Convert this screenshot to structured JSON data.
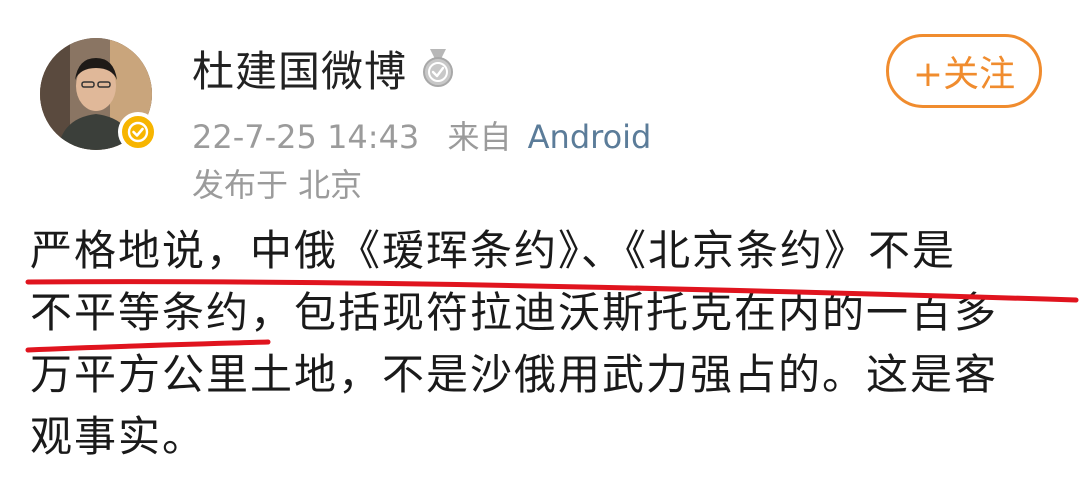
{
  "post": {
    "author": {
      "name": "杜建国微博",
      "avatar_icon": "person-photo",
      "verified_icon": "verified-checkmark-icon",
      "medal_icon": "medal-icon"
    },
    "meta": {
      "time": "22-7-25 14:43",
      "source_prefix": "来自",
      "source": "Android",
      "location": "发布于 北京"
    },
    "follow_button": {
      "label": "+关注"
    },
    "text_lines": [
      "严格地说，中俄《瑷珲条约》、《北京条约》不是",
      "不平等条约，包括现符拉迪沃斯托克在内的一百多",
      "万平方公里土地，不是沙俄用武力强占的。这是客",
      "观事实。"
    ],
    "colors": {
      "accent_orange": "#f08c2e",
      "verified_yellow": "#f7b500",
      "source_blue": "#5b7c99",
      "annotation_red": "#e0141e"
    }
  }
}
